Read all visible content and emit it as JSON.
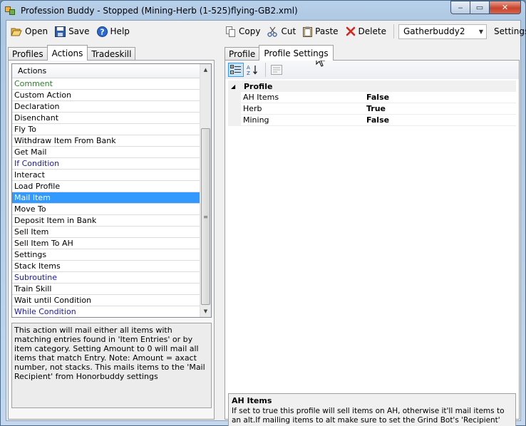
{
  "window": {
    "title": "Profession Buddy - Stopped (Mining-Herb (1-525)flying-GB2.xml)",
    "controls": {
      "minimize": "‒",
      "maximize": "▭",
      "close": "✕"
    }
  },
  "toolbar_left": {
    "open": "Open",
    "save": "Save",
    "help": "Help"
  },
  "toolbar_right": {
    "copy": "Copy",
    "cut": "Cut",
    "paste": "Paste",
    "delete": "Delete",
    "bot_combo": "Gatherbuddy2",
    "settings": "Settings"
  },
  "left_tabs": [
    "Profiles",
    "Actions",
    "Tradeskill"
  ],
  "right_tabs": [
    "Profile",
    "Profile Settings"
  ],
  "actions": {
    "header": "Actions",
    "items": [
      {
        "label": "Comment",
        "color": "green"
      },
      {
        "label": "Custom Action",
        "color": "black"
      },
      {
        "label": "Declaration",
        "color": "black"
      },
      {
        "label": "Disenchant",
        "color": "black"
      },
      {
        "label": "Fly To",
        "color": "black"
      },
      {
        "label": "Withdraw Item From Bank",
        "color": "black"
      },
      {
        "label": "Get Mail",
        "color": "black"
      },
      {
        "label": "If Condition",
        "color": "blue"
      },
      {
        "label": "Interact",
        "color": "black"
      },
      {
        "label": "Load Profile",
        "color": "black"
      },
      {
        "label": "Mail Item",
        "color": "selected"
      },
      {
        "label": "Move To",
        "color": "black"
      },
      {
        "label": "Deposit Item in Bank",
        "color": "black"
      },
      {
        "label": "Sell Item",
        "color": "black"
      },
      {
        "label": "Sell Item To AH",
        "color": "black"
      },
      {
        "label": "Settings",
        "color": "black"
      },
      {
        "label": "Stack Items",
        "color": "black"
      },
      {
        "label": "Subroutine",
        "color": "blue"
      },
      {
        "label": "Train Skill",
        "color": "black"
      },
      {
        "label": "Wait until Condition",
        "color": "black"
      },
      {
        "label": "While Condition",
        "color": "blue"
      }
    ],
    "description": "This action will mail either all items with matching entries found in 'Item Entries' or by item category. Setting Amount to 0 will mail all items that match Entry. Note: Amount = axact number, not stacks. This mails items to the 'Mail Recipient' from Honorbuddy settings"
  },
  "property_grid": {
    "category": "Profile",
    "rows": [
      {
        "name": "AH Items",
        "value": "False"
      },
      {
        "name": "Herb",
        "value": "True"
      },
      {
        "name": "Mining",
        "value": "False"
      }
    ],
    "help_title": "AH Items",
    "help_text": "If set to true this profile will sell items on AH, otherwise it'll mail items to an alt.If mailing items to alt make sure to set the Grind Bot's 'Recipient' field to your alts na..."
  }
}
